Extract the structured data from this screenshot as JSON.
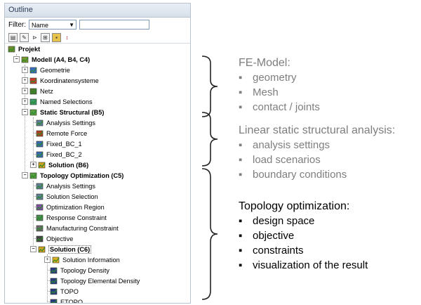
{
  "panel": {
    "title": "Outline",
    "filter_label": "Filter:",
    "filter_value": "Name",
    "filter_text": ""
  },
  "toolbar_icons": [
    "tree-view-icon",
    "properties-icon",
    "expand-icon",
    "collapse-icon",
    "folder-icon",
    "sort-icon"
  ],
  "tree": [
    {
      "label": "Projekt",
      "icon": "project-icon",
      "bold": true
    },
    {
      "label": "Modell (A4, B4, C4)",
      "icon": "model-icon",
      "bold": true
    },
    {
      "label": "Geometrie",
      "icon": "geometry-icon"
    },
    {
      "label": "Koordinatensysteme",
      "icon": "coordinate-systems-icon"
    },
    {
      "label": "Netz",
      "icon": "mesh-icon"
    },
    {
      "label": "Named Selections",
      "icon": "named-selections-icon"
    },
    {
      "label": "Static Structural (B5)",
      "icon": "static-structural-icon",
      "bold": true
    },
    {
      "label": "Analysis Settings",
      "icon": "analysis-settings-icon"
    },
    {
      "label": "Remote Force",
      "icon": "remote-force-icon"
    },
    {
      "label": "Fixed_BC_1",
      "icon": "fixed-support-icon"
    },
    {
      "label": "Fixed_BC_2",
      "icon": "fixed-support-icon"
    },
    {
      "label": "Solution (B6)",
      "icon": "solution-icon",
      "bold": true
    },
    {
      "label": "Topology Optimization (C5)",
      "icon": "topology-optimization-icon",
      "bold": true
    },
    {
      "label": "Analysis Settings",
      "icon": "analysis-settings-icon"
    },
    {
      "label": "Solution Selection",
      "icon": "solution-selection-icon"
    },
    {
      "label": "Optimization Region",
      "icon": "optimization-region-icon"
    },
    {
      "label": "Response Constraint",
      "icon": "response-constraint-icon"
    },
    {
      "label": "Manufacturing Constraint",
      "icon": "manufacturing-constraint-icon"
    },
    {
      "label": "Objective",
      "icon": "objective-icon"
    },
    {
      "label": "Solution (C6)",
      "icon": "solution-icon",
      "bold": true
    },
    {
      "label": "Solution Information",
      "icon": "solution-information-icon"
    },
    {
      "label": "Topology Density",
      "icon": "topology-density-icon"
    },
    {
      "label": "Topology Elemental Density",
      "icon": "topology-density-icon"
    },
    {
      "label": "TOPO",
      "icon": "result-icon"
    },
    {
      "label": "ETOPO",
      "icon": "result-icon"
    }
  ],
  "groups": {
    "fe_model": {
      "heading": "FE-Model:",
      "items": [
        "geometry",
        "Mesh",
        "contact / joints"
      ],
      "color": "#7e7e7e"
    },
    "linear_static": {
      "heading": "Linear static structural analysis:",
      "items": [
        "analysis settings",
        "load scenarios",
        "boundary conditions"
      ],
      "color": "#7e7e7e"
    },
    "topology": {
      "heading": "Topology optimization:",
      "items": [
        "design space",
        "objective",
        "constraints",
        "visualization of the result"
      ],
      "color": "#000000"
    }
  },
  "bullet": "▪"
}
